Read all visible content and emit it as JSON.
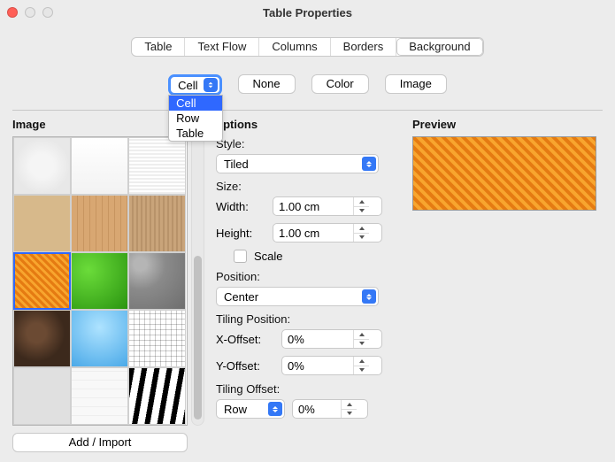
{
  "window": {
    "title": "Table Properties"
  },
  "tabs": {
    "table": "Table",
    "textflow": "Text Flow",
    "columns": "Columns",
    "borders": "Borders",
    "background": "Background"
  },
  "scope": {
    "current": "Cell",
    "options": {
      "cell": "Cell",
      "row": "Row",
      "table": "Table"
    }
  },
  "buttons": {
    "none": "None",
    "color": "Color",
    "image": "Image",
    "add_import": "Add / Import"
  },
  "sections": {
    "image": "Image",
    "options": "Options",
    "preview": "Preview"
  },
  "options": {
    "style_label": "Style:",
    "style_value": "Tiled",
    "size_label": "Size:",
    "width_label": "Width:",
    "width_value": "1.00 cm",
    "height_label": "Height:",
    "height_value": "1.00 cm",
    "scale_label": "Scale",
    "position_label": "Position:",
    "position_value": "Center",
    "tiling_position_label": "Tiling Position:",
    "xoffset_label": "X-Offset:",
    "xoffset_value": "0%",
    "yoffset_label": "Y-Offset:",
    "yoffset_value": "0%",
    "tiling_offset_label": "Tiling Offset:",
    "tiling_offset_axis": "Row",
    "tiling_offset_value": "0%"
  }
}
